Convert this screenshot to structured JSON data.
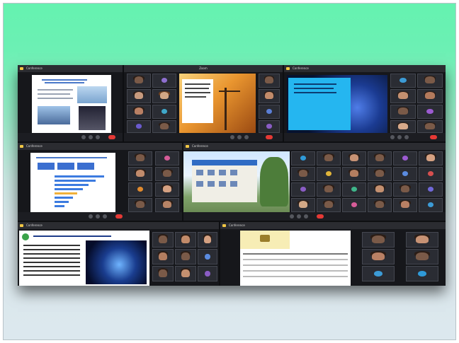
{
  "panels": [
    {
      "title": "Conference"
    },
    {
      "title": "Zoom"
    },
    {
      "title": "Conference"
    },
    {
      "title": "Conference"
    },
    {
      "title": "Conference"
    },
    {
      "title": "Conference"
    },
    {
      "title": "Conference"
    }
  ],
  "icons": {
    "app": "zoom-meeting-icon",
    "leave": "leave-button-icon"
  },
  "colors": {
    "background_top": "#65f2b0",
    "background_bottom": "#dce8ee",
    "leave_button": "#e53935",
    "panel_icon": "#f2c744"
  }
}
